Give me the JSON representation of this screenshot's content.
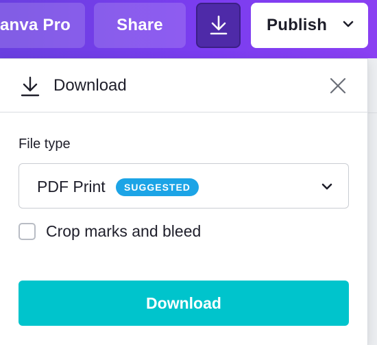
{
  "toolbar": {
    "canva_pro_label": "anva Pro",
    "share_label": "Share",
    "download_icon": "download-icon",
    "publish_label": "Publish",
    "publish_icon": "chevron-down-icon"
  },
  "panel": {
    "title": "Download",
    "title_icon": "download-icon",
    "close_icon": "close-icon",
    "file_type_label": "File type",
    "file_type_value": "PDF Print",
    "file_type_badge": "SUGGESTED",
    "crop_marks_label": "Crop marks and bleed",
    "crop_marks_checked": false,
    "download_button_label": "Download"
  },
  "colors": {
    "toolbar_purple": "#7b3df0",
    "download_active": "#4e2aa8",
    "badge_blue": "#1ca4e6",
    "download_teal": "#00c4cc"
  }
}
